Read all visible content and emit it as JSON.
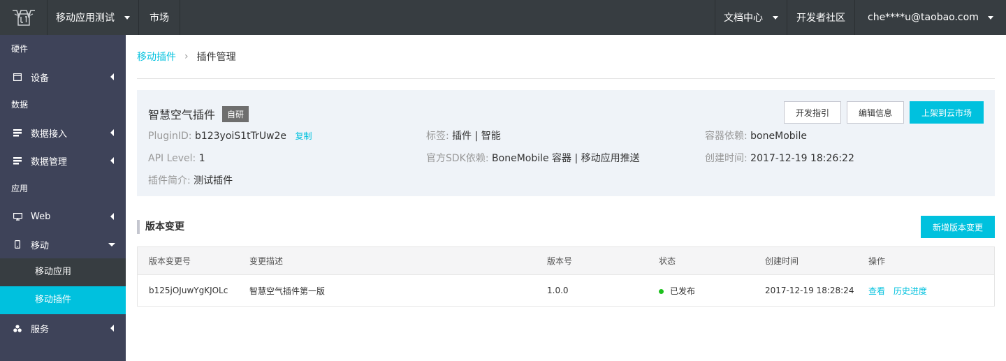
{
  "topbar": {
    "logo_icon": "brand-logo-icon",
    "app_select": "移动应用测试",
    "market": "市场",
    "docs": "文档中心",
    "community": "开发者社区",
    "user": "che****u@taobao.com"
  },
  "sidebar": {
    "groups": {
      "hardware": "硬件",
      "data": "数据",
      "app": "应用"
    },
    "items": {
      "device": "设备",
      "data_access": "数据接入",
      "data_manage": "数据管理",
      "web": "Web",
      "mobile": "移动",
      "mobile_app": "移动应用",
      "mobile_plugin": "移动插件",
      "service": "服务"
    }
  },
  "breadcrumb": {
    "parent": "移动插件",
    "separator": "›",
    "current": "插件管理"
  },
  "plugin": {
    "name": "智慧空气插件",
    "badge": "自研",
    "actions": {
      "guide": "开发指引",
      "edit": "编辑信息",
      "publish": "上架到云市场"
    },
    "plugin_id_label": "PluginID:",
    "plugin_id_value": "b123yoiS1tTrUw2e",
    "copy": "复制",
    "tags_label": "标签:",
    "tags_value": "插件 | 智能",
    "container_label": "容器依赖:",
    "container_value": "boneMobile",
    "api_label": "API Level:",
    "api_value": "1",
    "sdk_label": "官方SDK依赖:",
    "sdk_value": "BoneMobile 容器 | 移动应用推送",
    "created_label": "创建时间:",
    "created_value": "2017-12-19 18:26:22",
    "intro_label": "插件简介:",
    "intro_value": "测试插件"
  },
  "versions": {
    "title": "版本变更",
    "add_button": "新增版本变更",
    "columns": {
      "change_id": "版本变更号",
      "description": "变更描述",
      "version": "版本号",
      "status": "状态",
      "created": "创建时间",
      "ops": "操作"
    },
    "rows": [
      {
        "change_id": "b125jOJuwYgKJOLc",
        "description": "智慧空气插件第一版",
        "version": "1.0.0",
        "status": "已发布",
        "created": "2017-12-19 18:28:24",
        "view": "查看",
        "history": "历史进度"
      }
    ],
    "status_color": "#1dc11d"
  },
  "colors": {
    "accent": "#00c1de",
    "topbar": "#373d41",
    "sidebar": "#3e4359"
  }
}
